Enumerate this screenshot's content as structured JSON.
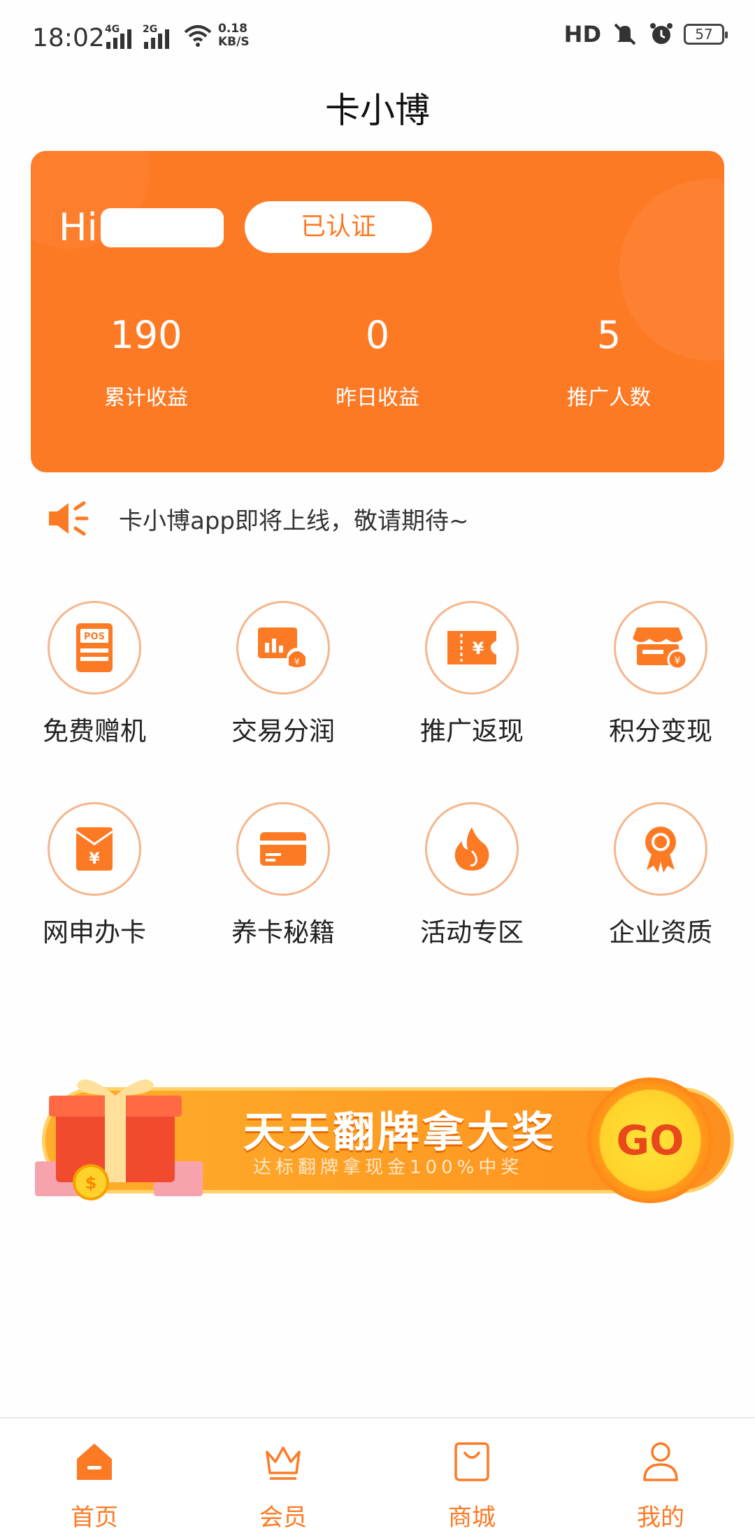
{
  "status_bar": {
    "time": "18:02",
    "signal1_label": "4G",
    "signal2_label": "2G",
    "speed_value": "0.18",
    "speed_unit": "KB/S",
    "hd_label": "HD",
    "battery": "57"
  },
  "app_title": "卡小博",
  "profile_card": {
    "greeting": "Hi",
    "verified_label": "已认证",
    "stats": [
      {
        "value": "190",
        "label": "累计收益"
      },
      {
        "value": "0",
        "label": "昨日收益"
      },
      {
        "value": "5",
        "label": "推广人数"
      }
    ]
  },
  "notice": {
    "text": "卡小博app即将上线，敬请期待~"
  },
  "grid": [
    {
      "label": "免费赠机",
      "icon": "pos-machine-icon"
    },
    {
      "label": "交易分润",
      "icon": "trade-share-icon"
    },
    {
      "label": "推广返现",
      "icon": "coupon-icon"
    },
    {
      "label": "积分变现",
      "icon": "store-points-icon"
    },
    {
      "label": "网申办卡",
      "icon": "envelope-yuan-icon"
    },
    {
      "label": "养卡秘籍",
      "icon": "card-icon"
    },
    {
      "label": "活动专区",
      "icon": "flame-icon"
    },
    {
      "label": "企业资质",
      "icon": "badge-icon"
    }
  ],
  "banner": {
    "title": "天天翻牌拿大奖",
    "subtitle": "达标翻牌拿现金100%中奖",
    "go_label": "GO"
  },
  "bottom_nav": [
    {
      "label": "首页",
      "icon": "home-icon"
    },
    {
      "label": "会员",
      "icon": "crown-icon"
    },
    {
      "label": "商城",
      "icon": "shopping-bag-icon"
    },
    {
      "label": "我的",
      "icon": "user-icon"
    }
  ],
  "colors": {
    "accent": "#fd7a25",
    "icon_ring": "#f6b58b",
    "banner_yellow": "#ffd22b"
  }
}
